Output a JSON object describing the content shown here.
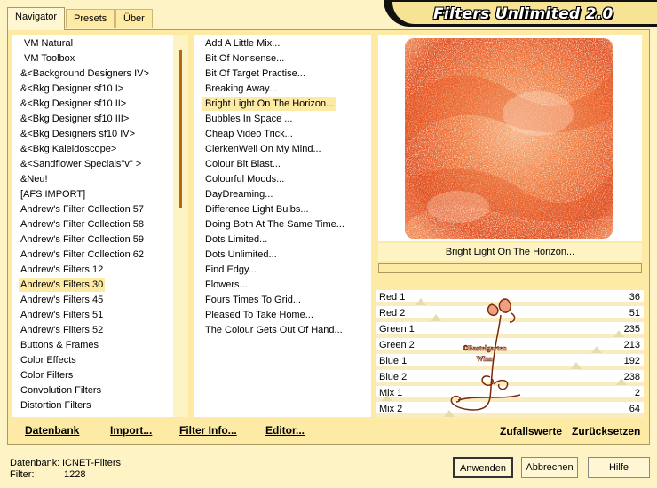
{
  "tabs": [
    {
      "label": "Navigator",
      "active": true
    },
    {
      "label": "Presets",
      "active": false
    },
    {
      "label": "Über",
      "active": false
    }
  ],
  "brand": {
    "title": "Filters Unlimited 2.0"
  },
  "categories": [
    "VM Natural",
    "VM Toolbox",
    "&<Background Designers IV>",
    "&<Bkg Designer sf10 I>",
    "&<Bkg Designer sf10 II>",
    "&<Bkg Designer sf10 III>",
    "&<Bkg Designers sf10 IV>",
    "&<Bkg Kaleidoscope>",
    "&<Sandflower Specials\"v\" >",
    "&Neu!",
    "[AFS IMPORT]",
    "Andrew's Filter Collection 57",
    "Andrew's Filter Collection 58",
    "Andrew's Filter Collection 59",
    "Andrew's Filter Collection 62",
    "Andrew's Filters 12",
    "Andrew's Filters 30",
    "Andrew's Filters 45",
    "Andrew's Filters 51",
    "Andrew's Filters 52",
    "Buttons & Frames",
    "Color Effects",
    "Color Filters",
    "Convolution Filters",
    "Distortion Filters"
  ],
  "selected_category": "Andrew's Filters 30",
  "filters": [
    "Add A Little Mix...",
    "Bit Of Nonsense...",
    "Bit Of Target Practise...",
    "Breaking Away...",
    "Bright Light On The Horizon...",
    "Bubbles In Space ...",
    "Cheap Video Trick...",
    "ClerkenWell On My Mind...",
    "Colour Bit Blast...",
    "Colourful Moods...",
    "DayDreaming...",
    "Difference Light Bulbs...",
    "Doing Both At The Same Time...",
    "Dots Limited...",
    "Dots Unlimited...",
    "Find Edgy...",
    "Flowers...",
    "Fours Times To Grid...",
    "Pleased To Take Home...",
    "The Colour Gets Out Of Hand..."
  ],
  "selected_filter": "Bright Light On The Horizon...",
  "preview": {
    "caption": "Bright Light On The Horizon..."
  },
  "watermark": {
    "text": "©Bastelgarten Winn"
  },
  "sliders": [
    {
      "label": "Red 1",
      "value": 36
    },
    {
      "label": "Red 2",
      "value": 51
    },
    {
      "label": "Green 1",
      "value": 235
    },
    {
      "label": "Green 2",
      "value": 213
    },
    {
      "label": "Blue 1",
      "value": 192
    },
    {
      "label": "Blue 2",
      "value": 238
    },
    {
      "label": "Mix 1",
      "value": 2
    },
    {
      "label": "Mix 2",
      "value": 64
    }
  ],
  "panel_buttons": {
    "datenbank": "Datenbank",
    "import": "Import...",
    "filter_info": "Filter Info...",
    "editor": "Editor...",
    "random": "Zufallswerte",
    "reset": "Zurücksetzen"
  },
  "status": {
    "db_label": "Datenbank:",
    "db_value": "ICNET-Filters",
    "filter_label": "Filter:",
    "filter_value": "1228"
  },
  "footer_buttons": {
    "apply": "Anwenden",
    "cancel": "Abbrechen",
    "help": "Hilfe"
  },
  "colors": {
    "bg": "#fdf3c4",
    "panel": "#fdeaa4",
    "accent": "#b06a14",
    "preview_base": "#ef6a2a"
  }
}
